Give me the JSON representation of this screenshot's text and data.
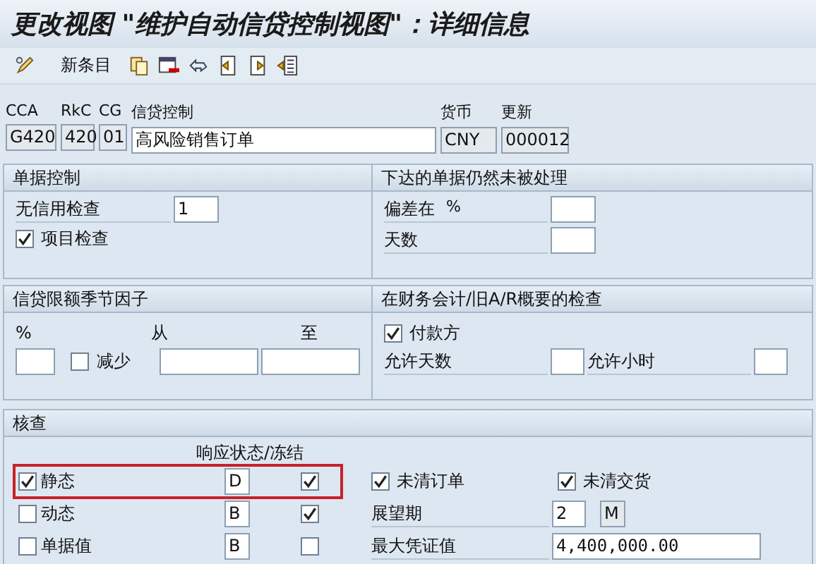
{
  "title": "更改视图 \"维护自动信贷控制视图\"：详细信息",
  "toolbar": {
    "new_entries": "新条目"
  },
  "header": [
    {
      "label": "CCA",
      "value": "G420",
      "editable": false
    },
    {
      "label": "RkC",
      "value": "420",
      "editable": false
    },
    {
      "label": "CG",
      "value": "01",
      "editable": false
    },
    {
      "label": "信贷控制",
      "value": "高风险销售订单",
      "editable": true
    },
    {
      "label": "货币",
      "value": "CNY",
      "editable": false
    },
    {
      "label": "更新",
      "value": "000012",
      "editable": false
    }
  ],
  "document_control": {
    "title": "单据控制",
    "no_credit_check": {
      "label": "无信用检查",
      "value": "1"
    },
    "item_check": {
      "label": "项目检查",
      "checked": true
    }
  },
  "released_documents": {
    "title": "下达的单据仍然未被处理",
    "deviation": {
      "label": "偏差在",
      "unit": "%"
    },
    "days": {
      "label": "天数"
    }
  },
  "seasonal_factor": {
    "title": "信贷限额季节因子",
    "percent_label": "%",
    "from_label": "从",
    "to_label": "至",
    "reduce": {
      "label": "减少",
      "checked": false
    }
  },
  "fi_check": {
    "title": "在财务会计/旧A/R概要的检查",
    "payer": {
      "label": "付款方",
      "checked": true
    },
    "allowed_days": "允许天数",
    "allowed_hours": "允许小时"
  },
  "checks": {
    "title": "核查",
    "column_header": "响应状态/冻结",
    "rows": [
      {
        "label": "静态",
        "checked": true,
        "reaction": "D",
        "block": true,
        "highlighted": true
      },
      {
        "label": "动态",
        "checked": false,
        "reaction": "B",
        "block": true,
        "highlighted": false
      },
      {
        "label": "单据值",
        "checked": false,
        "reaction": "B",
        "block": false,
        "highlighted": false
      }
    ],
    "open_orders": {
      "label": "未清订单",
      "checked": true
    },
    "open_deliveries": {
      "label": "未清交货",
      "checked": true
    },
    "horizon": {
      "label": "展望期",
      "value": "2",
      "unit": "M"
    },
    "max_document_value": {
      "label": "最大凭证值",
      "value": "4,400,000.00"
    }
  }
}
